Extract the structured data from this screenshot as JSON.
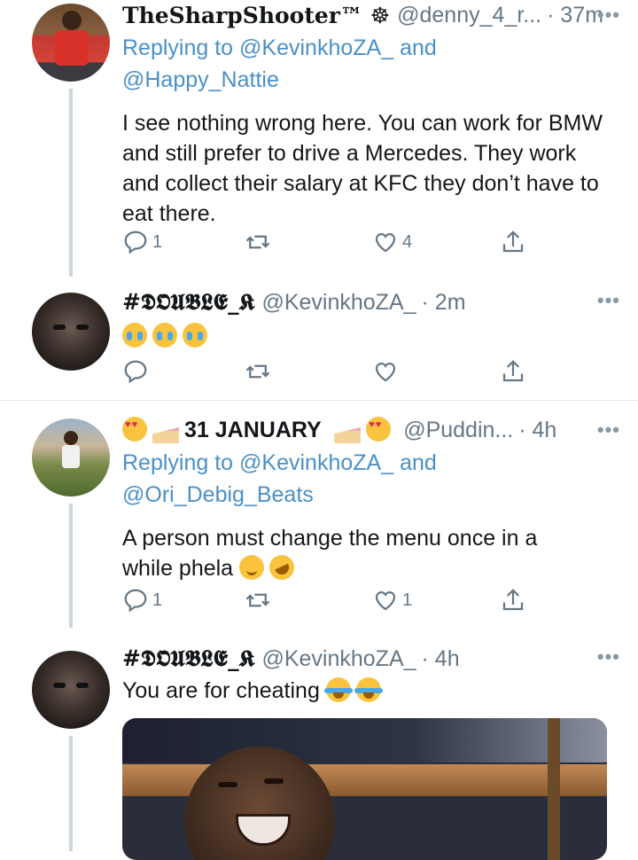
{
  "tweets": [
    {
      "name": "TheSharpShooter™",
      "name_symbol": "☸",
      "handle": "@denny_4_r...",
      "time": "· 37m",
      "reply_prefix": "Replying to",
      "reply_to_1": "@KevinkhoZA_",
      "reply_and": "and",
      "reply_to_2": "@Happy_Nattie",
      "text": "I see nothing wrong here. You can work for BMW and still prefer to drive a Mercedes. They work and collect their salary at KFC they don’t have to eat there.",
      "replies": "1",
      "retweets": "",
      "likes": "4"
    },
    {
      "name": "#𝕯𝕺𝖀𝕭𝕷𝕰_𝕶",
      "handle": "@KevinkhoZA_",
      "time": "· 2m",
      "emojis": [
        "loudly-crying-face",
        "loudly-crying-face",
        "loudly-crying-face"
      ],
      "replies": "",
      "retweets": "",
      "likes": ""
    },
    {
      "name": "31 JANUARY",
      "name_emojis": [
        "smiling-cat-heart-eyes",
        "cake-slice",
        "cake-slice",
        "smiling-cat-heart-eyes"
      ],
      "handle": "@Puddin...",
      "time": "· 4h",
      "reply_prefix": "Replying to",
      "reply_to_1": "@KevinkhoZA_",
      "reply_and": "and",
      "reply_to_2": "@Ori_Debig_Beats",
      "text_line_1": "A person must change the menu once in a",
      "text_line_2": "while phela",
      "text_emojis": [
        "smiling-face",
        "rolling-on-floor-laughing"
      ],
      "replies": "1",
      "retweets": "",
      "likes": "1"
    },
    {
      "name": "#𝕯𝕺𝖀𝕭𝕷𝕰_𝕶",
      "handle": "@KevinkhoZA_",
      "time": "· 4h",
      "text": "You are for cheating",
      "text_emojis": [
        "face-with-tears-of-joy",
        "face-with-tears-of-joy"
      ]
    }
  ],
  "icons": {
    "reply": "reply-icon",
    "retweet": "retweet-icon",
    "like": "heart-icon",
    "share": "share-icon",
    "more": "more-icon"
  },
  "colors": {
    "link": "#4a90c8",
    "muted": "#657786",
    "thread_line": "#ccd6dd"
  }
}
